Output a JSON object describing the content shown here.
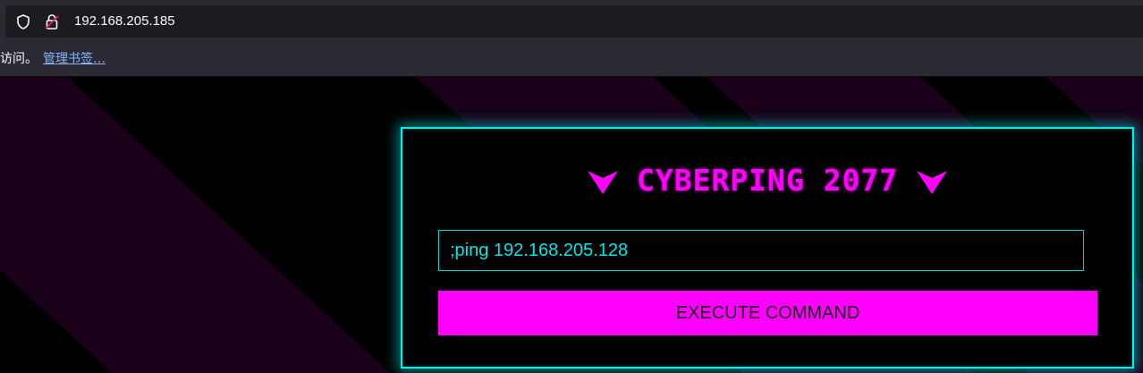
{
  "browser": {
    "url": "192.168.205.185",
    "bookmarks_prefix": "访问。",
    "bookmarks_link": "管理书签…"
  },
  "app": {
    "title": "CYBERPING 2077",
    "input_value": ";ping 192.168.205.128",
    "execute_label": "EXECUTE COMMAND"
  },
  "icons": {
    "shield": "shield-icon",
    "lock": "lock-icon",
    "chevron": "chevron-down-icon"
  },
  "colors": {
    "accent_magenta": "#ff00ff",
    "accent_cyan": "#00f0f0",
    "background": "#000000",
    "stripe": "#1a0018"
  }
}
